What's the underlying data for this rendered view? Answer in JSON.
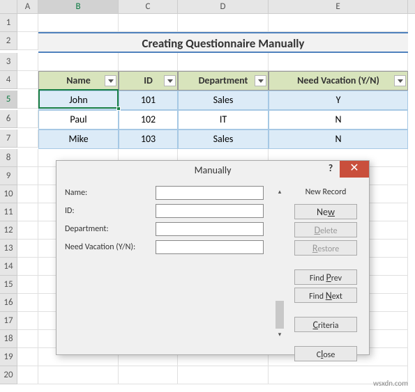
{
  "columns": [
    "A",
    "B",
    "C",
    "D",
    "E"
  ],
  "title": "Creating Questionnaire Manually",
  "headers": {
    "name": "Name",
    "id": "ID",
    "dept": "Department",
    "vac": "Need Vacation (Y/N)"
  },
  "rows": [
    {
      "name": "John",
      "id": "101",
      "dept": "Sales",
      "vac": "Y"
    },
    {
      "name": "Paul",
      "id": "102",
      "dept": "IT",
      "vac": "N"
    },
    {
      "name": "Mike",
      "id": "103",
      "dept": "Sales",
      "vac": "N"
    }
  ],
  "active": {
    "row": 5,
    "col": "B"
  },
  "dialog": {
    "title": "Manually",
    "status": "New Record",
    "labels": {
      "name": "Name:",
      "id": "ID:",
      "dept": "Department:",
      "vac": "Need Vacation (Y/N):"
    },
    "values": {
      "name": "",
      "id": "",
      "dept": "",
      "vac": ""
    },
    "buttons": {
      "new": "New",
      "delete": "Delete",
      "restore": "Restore",
      "findprev": "Find Prev",
      "findnext": "Find Next",
      "criteria": "Criteria",
      "close": "Close"
    }
  },
  "watermark": "wsxdn.com",
  "chart_data": {
    "type": "table",
    "title": "Creating Questionnaire Manually",
    "columns": [
      "Name",
      "ID",
      "Department",
      "Need Vacation (Y/N)"
    ],
    "rows": [
      [
        "John",
        101,
        "Sales",
        "Y"
      ],
      [
        "Paul",
        102,
        "IT",
        "N"
      ],
      [
        "Mike",
        103,
        "Sales",
        "N"
      ]
    ]
  }
}
